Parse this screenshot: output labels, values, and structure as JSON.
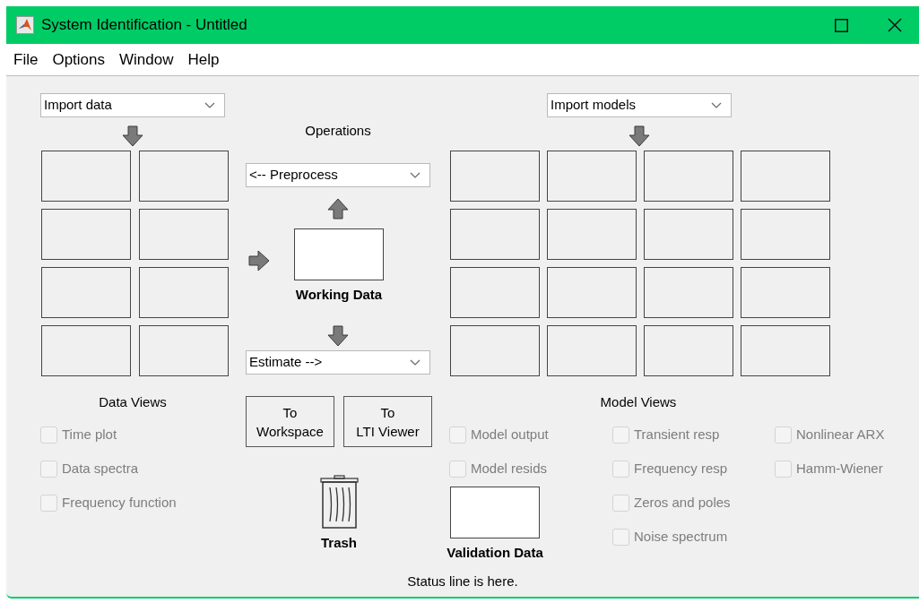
{
  "window": {
    "title": "System Identification - Untitled"
  },
  "menu": [
    "File",
    "Options",
    "Window",
    "Help"
  ],
  "data_import": {
    "value": "Import data"
  },
  "operations": {
    "title": "Operations",
    "preprocess": "<-- Preprocess",
    "working_data": "Working Data",
    "estimate": "Estimate -->"
  },
  "export_buttons": [
    {
      "line1": "To",
      "line2": "Workspace"
    },
    {
      "line1": "To",
      "line2": "LTI Viewer"
    }
  ],
  "trash": {
    "label": "Trash"
  },
  "model_import": {
    "value": "Import models"
  },
  "data_views": {
    "title": "Data Views",
    "options": [
      {
        "label": "Time plot",
        "checked": false,
        "disabled": true
      },
      {
        "label": "Data spectra",
        "checked": false,
        "disabled": true
      },
      {
        "label": "Frequency function",
        "checked": false,
        "disabled": true
      }
    ]
  },
  "model_views": {
    "title": "Model Views",
    "columns": [
      [
        {
          "label": "Model output",
          "checked": false,
          "disabled": true
        },
        {
          "label": "Model resids",
          "checked": false,
          "disabled": true
        }
      ],
      [
        {
          "label": "Transient resp",
          "checked": false,
          "disabled": true
        },
        {
          "label": "Frequency resp",
          "checked": false,
          "disabled": true
        },
        {
          "label": "Zeros and poles",
          "checked": false,
          "disabled": true
        },
        {
          "label": "Noise spectrum",
          "checked": false,
          "disabled": true
        }
      ],
      [
        {
          "label": "Nonlinear ARX",
          "checked": false,
          "disabled": true
        },
        {
          "label": "Hamm-Wiener",
          "checked": false,
          "disabled": true
        }
      ]
    ]
  },
  "validation": {
    "label": "Validation Data"
  },
  "status_line": "Status line is here."
}
